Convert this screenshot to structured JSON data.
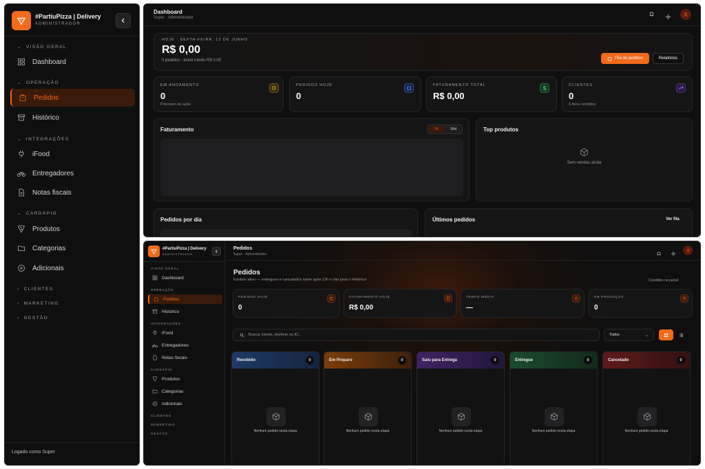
{
  "colors": {
    "accent": "#f26a1b",
    "bg": "#0f0f10"
  },
  "sidebar": {
    "brand": "#PartiuPizza | Delivery",
    "role": "ADMINISTRADOR",
    "sections": {
      "overview": "VISÃO GERAL",
      "operation": "OPERAÇÃO",
      "integrations": "INTEGRAÇÕES",
      "menu": "CARDÁPIO",
      "clients": "CLIENTES",
      "marketing": "MARKETING",
      "management": "GESTÃO"
    },
    "items": {
      "dashboard": "Dashboard",
      "orders": "Pedidos",
      "history": "Histórico",
      "ifood": "iFood",
      "couriers": "Entregadores",
      "invoices": "Notas fiscais",
      "products": "Produtos",
      "categories": "Categorias",
      "addons": "Adicionais"
    },
    "footer": "Logado como Super"
  },
  "dashboard": {
    "title": "Dashboard",
    "subtitle": "Super · Administrador",
    "today_label": "HOJE · SEXTA-FEIRA, 12 DE JUNHO",
    "today_value": "R$ 0,00",
    "today_sub": "0 pedidos · ticket médio R$ 0,00",
    "btn_queue": "Fila de pedidos",
    "btn_reports": "Relatórios",
    "stats": [
      {
        "label": "EM ANDAMENTO",
        "value": "0",
        "sub": "Precisam de ação",
        "color": "#d4a72c"
      },
      {
        "label": "PEDIDOS HOJE",
        "value": "0",
        "sub": "",
        "color": "#4a8fe0"
      },
      {
        "label": "FATURAMENTO TOTAL",
        "value": "R$ 0,00",
        "sub": "",
        "color": "#3fbf6a"
      },
      {
        "label": "CLIENTES",
        "value": "0",
        "sub": "0 itens vendidos",
        "color": "#a06ae0"
      }
    ],
    "revenue_title": "Faturamento",
    "toggle_7": "7d",
    "toggle_30": "30d",
    "top_products_title": "Top produtos",
    "top_products_empty": "Sem vendas ainda",
    "orders_per_day": "Pedidos por dia",
    "latest_orders": "Últimos pedidos",
    "see_queue": "Ver fila"
  },
  "orders_page": {
    "header_title": "Pedidos",
    "header_subtitle": "Super · Administrador",
    "title": "Pedidos",
    "subtitle": "Kanban ativo — entregues e cancelados saem após 12h e vão para o Histórico",
    "panel_count": "0 pedidos no painel",
    "stats": [
      {
        "label": "PEDIDOS HOJE",
        "value": "0"
      },
      {
        "label": "FATURAMENTO HOJE",
        "value": "R$ 0,00"
      },
      {
        "label": "TEMPO MÉDIO",
        "value": "—"
      },
      {
        "label": "EM PRODUÇÃO",
        "value": "0"
      }
    ],
    "search_placeholder": "Buscar cliente, telefone ou ID...",
    "filter_value": "Todos",
    "columns": [
      {
        "name": "Recebido",
        "count": "0",
        "color": "#1e3a66"
      },
      {
        "name": "Em Preparo",
        "count": "0",
        "color": "#7a3d0c"
      },
      {
        "name": "Saiu para Entrega",
        "count": "0",
        "color": "#3e2466"
      },
      {
        "name": "Entregue",
        "count": "0",
        "color": "#1b4a2c"
      },
      {
        "name": "Cancelado",
        "count": "0",
        "color": "#5e1a1a"
      }
    ],
    "empty_column": "Nenhum pedido nesta etapa"
  }
}
